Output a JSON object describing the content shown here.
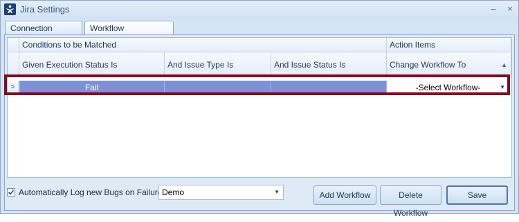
{
  "window": {
    "title": "Jira Settings",
    "minimize_glyph": "–",
    "close_glyph": "×"
  },
  "tabs": [
    {
      "label": "Connection Settings"
    },
    {
      "label": "Workflow Configuration",
      "active": true
    }
  ],
  "grid": {
    "group_headers": {
      "conditions": "Conditions to be Matched",
      "actions": "Action Items"
    },
    "columns": [
      "Given Execution Status Is",
      "And Issue Type Is",
      "And Issue Status Is",
      "Change Workflow To"
    ],
    "sort_glyph": "▲",
    "rows": [
      {
        "indicator": ">",
        "execution_status": "Fail",
        "issue_type": "",
        "issue_status": "",
        "workflow": "-Select Workflow-"
      }
    ],
    "selection_color": "#7d91d5",
    "highlight_color": "#7a1020"
  },
  "footer": {
    "auto_log_label": "Automatically Log new Bugs on Failure",
    "auto_log_checked": true,
    "project_value": "Demo",
    "buttons": {
      "add": "Add Workflow",
      "delete": "Delete Workflow",
      "save": "Save"
    }
  },
  "icons": {
    "app": "jira-app-icon",
    "check": "check-icon",
    "dropdown": "chevron-down-icon"
  }
}
